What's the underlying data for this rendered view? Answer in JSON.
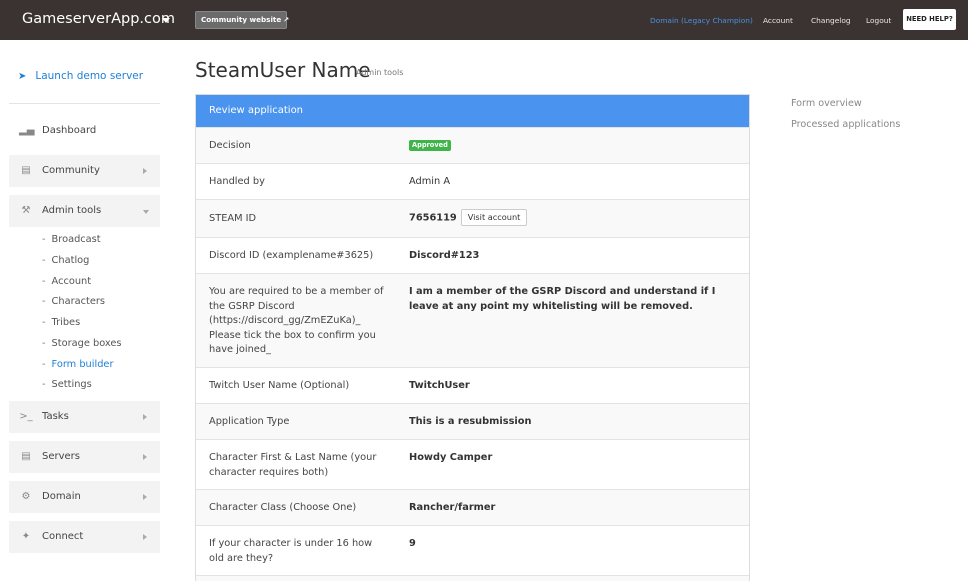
{
  "header": {
    "brand": "GameserverApp.com",
    "community_button": "Community website",
    "nav": {
      "domain": "Domain (Legacy Champion)",
      "account": "Account",
      "changelog": "Changelog",
      "logout": "Logout",
      "help": "NEED HELP?"
    }
  },
  "sidebar": {
    "demo": "Launch demo server",
    "items": {
      "dashboard": "Dashboard",
      "community": "Community",
      "admin_tools": "Admin tools",
      "tasks": "Tasks",
      "servers": "Servers",
      "domain": "Domain",
      "connect": "Connect"
    },
    "admin_submenu": {
      "broadcast": "Broadcast",
      "chatlog": "Chatlog",
      "account": "Account",
      "characters": "Characters",
      "tribes": "Tribes",
      "storage_boxes": "Storage boxes",
      "form_builder": "Form builder",
      "settings": "Settings"
    }
  },
  "main": {
    "title": "SteamUser Name",
    "subtitle": "Admin tools",
    "panel_title": "Review application",
    "rows": {
      "decision": {
        "label": "Decision",
        "badge": "Approved"
      },
      "handled_by": {
        "label": "Handled by",
        "value": "Admin A"
      },
      "steam_id": {
        "label": "STEAM ID",
        "value": "7656119",
        "button": "Visit account"
      },
      "discord_id": {
        "label": "Discord ID (examplename#3625)",
        "value": "Discord#123"
      },
      "discord_member": {
        "label": "You are required to be a member of the GSRP Discord (https://discord_gg/ZmEZuKa)_ Please tick the box to confirm you have joined_",
        "value": "I am a member of the GSRP Discord and understand if I leave at any point my whitelisting will be removed."
      },
      "twitch": {
        "label": "Twitch User Name (Optional)",
        "value": "TwitchUser"
      },
      "application_type": {
        "label": "Application Type",
        "value": "This is a resubmission"
      },
      "character_name": {
        "label": "Character First & Last Name (your character requires both)",
        "value": "Howdy Camper"
      },
      "character_class": {
        "label": "Character Class (Choose One)",
        "value": "Rancher/farmer"
      },
      "character_age": {
        "label": "If your character is under 16 how old are they?",
        "value": "9"
      }
    }
  },
  "rightnav": {
    "form_overview": "Form overview",
    "processed": "Processed applications"
  },
  "colors": {
    "topbar": "#3a3331",
    "accent_blue": "#4a93ef",
    "link_blue": "#1f7fd6",
    "approved_green": "#3fb44a"
  }
}
